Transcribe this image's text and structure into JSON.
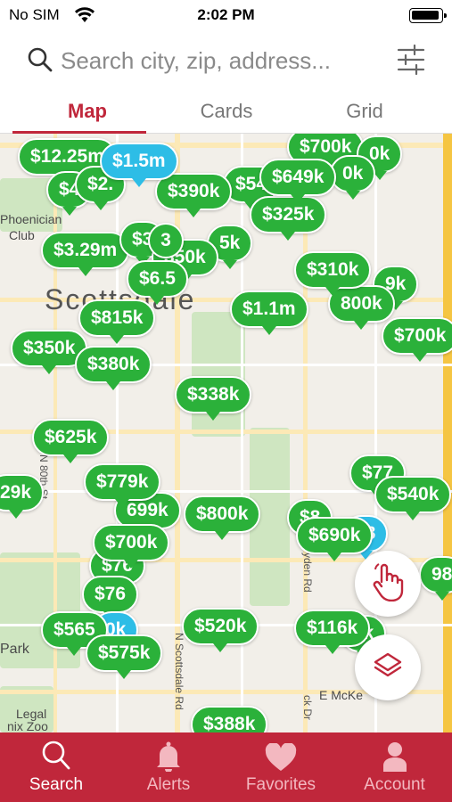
{
  "status": {
    "carrier": "No SIM",
    "time": "2:02 PM"
  },
  "search": {
    "placeholder": "Search city, zip, address..."
  },
  "tabs": [
    {
      "label": "Map",
      "active": true
    },
    {
      "label": "Cards",
      "active": false
    },
    {
      "label": "Grid",
      "active": false
    }
  ],
  "map": {
    "city_label": "Scottsdale",
    "labels": {
      "phoenician_1": "Phoenician",
      "phoenician_2": "Club",
      "park": "Park",
      "legal": "Legal",
      "zoo": "nix Zoo",
      "north_st": "N 80th St",
      "scottsdale_rd": "N Scottsdale Rd",
      "hayden_rd": "yden Rd",
      "mckellips": "E McKe",
      "ck_dr": "ck Dr"
    },
    "pins": {
      "p1": "$12.25m",
      "p2": "$1.5m",
      "p3": "$700k",
      "p4": "0k",
      "p5": "$4",
      "p6": "$2.",
      "p7": "$390k",
      "p8": "$54",
      "p9": "$649k",
      "p10": "0k",
      "p11": "$325k",
      "p12": "$3.29m",
      "p13": "$3",
      "p14": "3",
      "p15": "5k",
      "p16": "350k",
      "p17": "$6.5",
      "p18": "$310k",
      "p19": "9k",
      "p20": "800k",
      "p21": "$815k",
      "p22": "$1.1m",
      "p23": "$700k",
      "p24": "$350k",
      "p25": "$380k",
      "p26": "$338k",
      "p27": "$625k",
      "p28": "29k",
      "p29": "$779k",
      "p30": "$77",
      "p31": "$540k",
      "p32": "699k",
      "p33": "$800k",
      "p34": "$690k",
      "p35": "$700k",
      "p36": "$8",
      "p37": "$76",
      "p38": "98",
      "p39": "$565",
      "p40": "$520k",
      "p41": "$116k",
      "p42": "0k",
      "p43": "$575k",
      "p44": "$388k"
    }
  },
  "bottom_nav": [
    {
      "label": "Search",
      "icon": "search-icon",
      "active": true
    },
    {
      "label": "Alerts",
      "icon": "bell-icon",
      "active": false
    },
    {
      "label": "Favorites",
      "icon": "heart-icon",
      "active": false
    },
    {
      "label": "Account",
      "icon": "person-icon",
      "active": false
    }
  ],
  "colors": {
    "brand": "#c0273b",
    "pin_green": "#2bb13a",
    "pin_blue": "#2dbde6"
  }
}
